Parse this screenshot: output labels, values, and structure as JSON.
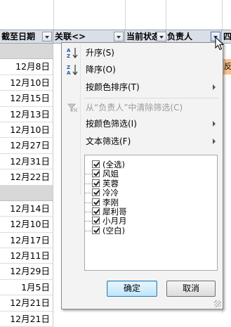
{
  "headers": [
    {
      "label": "截至日期"
    },
    {
      "label": "关联<>"
    },
    {
      "label": "当前状态"
    },
    {
      "label": "负责人"
    },
    {
      "label": "四"
    }
  ],
  "rows": [
    {
      "value": "",
      "band": true
    },
    {
      "value": "12月8日"
    },
    {
      "value": "12月10日"
    },
    {
      "value": "12月15日"
    },
    {
      "value": "12月13日"
    },
    {
      "value": "12月10日"
    },
    {
      "value": "12月27日"
    },
    {
      "value": "12月31日"
    },
    {
      "value": "12月22日"
    },
    {
      "value": "",
      "band": true
    },
    {
      "value": "12月14日"
    },
    {
      "value": "12月10日"
    },
    {
      "value": "12月17日"
    },
    {
      "value": "12月11日"
    },
    {
      "value": "12月29日"
    },
    {
      "value": "1月5日"
    },
    {
      "value": "12月21日"
    },
    {
      "value": "12月21日"
    }
  ],
  "orange_cell_text": "反",
  "menu": {
    "sort_asc": "升序(S)",
    "sort_desc": "降序(O)",
    "sort_by_color": "按颜色排序(T)",
    "clear_filter": "从“负责人”中清除筛选(C)",
    "filter_by_color": "按颜色筛选(I)",
    "text_filter": "文本筛选(F)",
    "items": [
      {
        "label": "(全选)",
        "checked": true
      },
      {
        "label": "风姐",
        "checked": true
      },
      {
        "label": "芙蓉",
        "checked": true
      },
      {
        "label": "冷冷",
        "checked": true
      },
      {
        "label": "李刚",
        "checked": true
      },
      {
        "label": "犀利哥",
        "checked": true
      },
      {
        "label": "小月月",
        "checked": true
      },
      {
        "label": "(空白)",
        "checked": true
      }
    ],
    "ok": "确定",
    "cancel": "取消"
  },
  "colors": {
    "header_bg": "#dadfe7",
    "band": "#d8d8d8",
    "menu_bg": "#f3f3f3",
    "orange_cell": "#f6c28e",
    "default_button": "#bee6fd"
  },
  "icons": [
    "sort-ascending-icon",
    "sort-descending-icon",
    "clear-filter-icon",
    "submenu-arrow-icon",
    "checkbox-icon",
    "resize-grip-icon",
    "mouse-cursor-icon"
  ]
}
